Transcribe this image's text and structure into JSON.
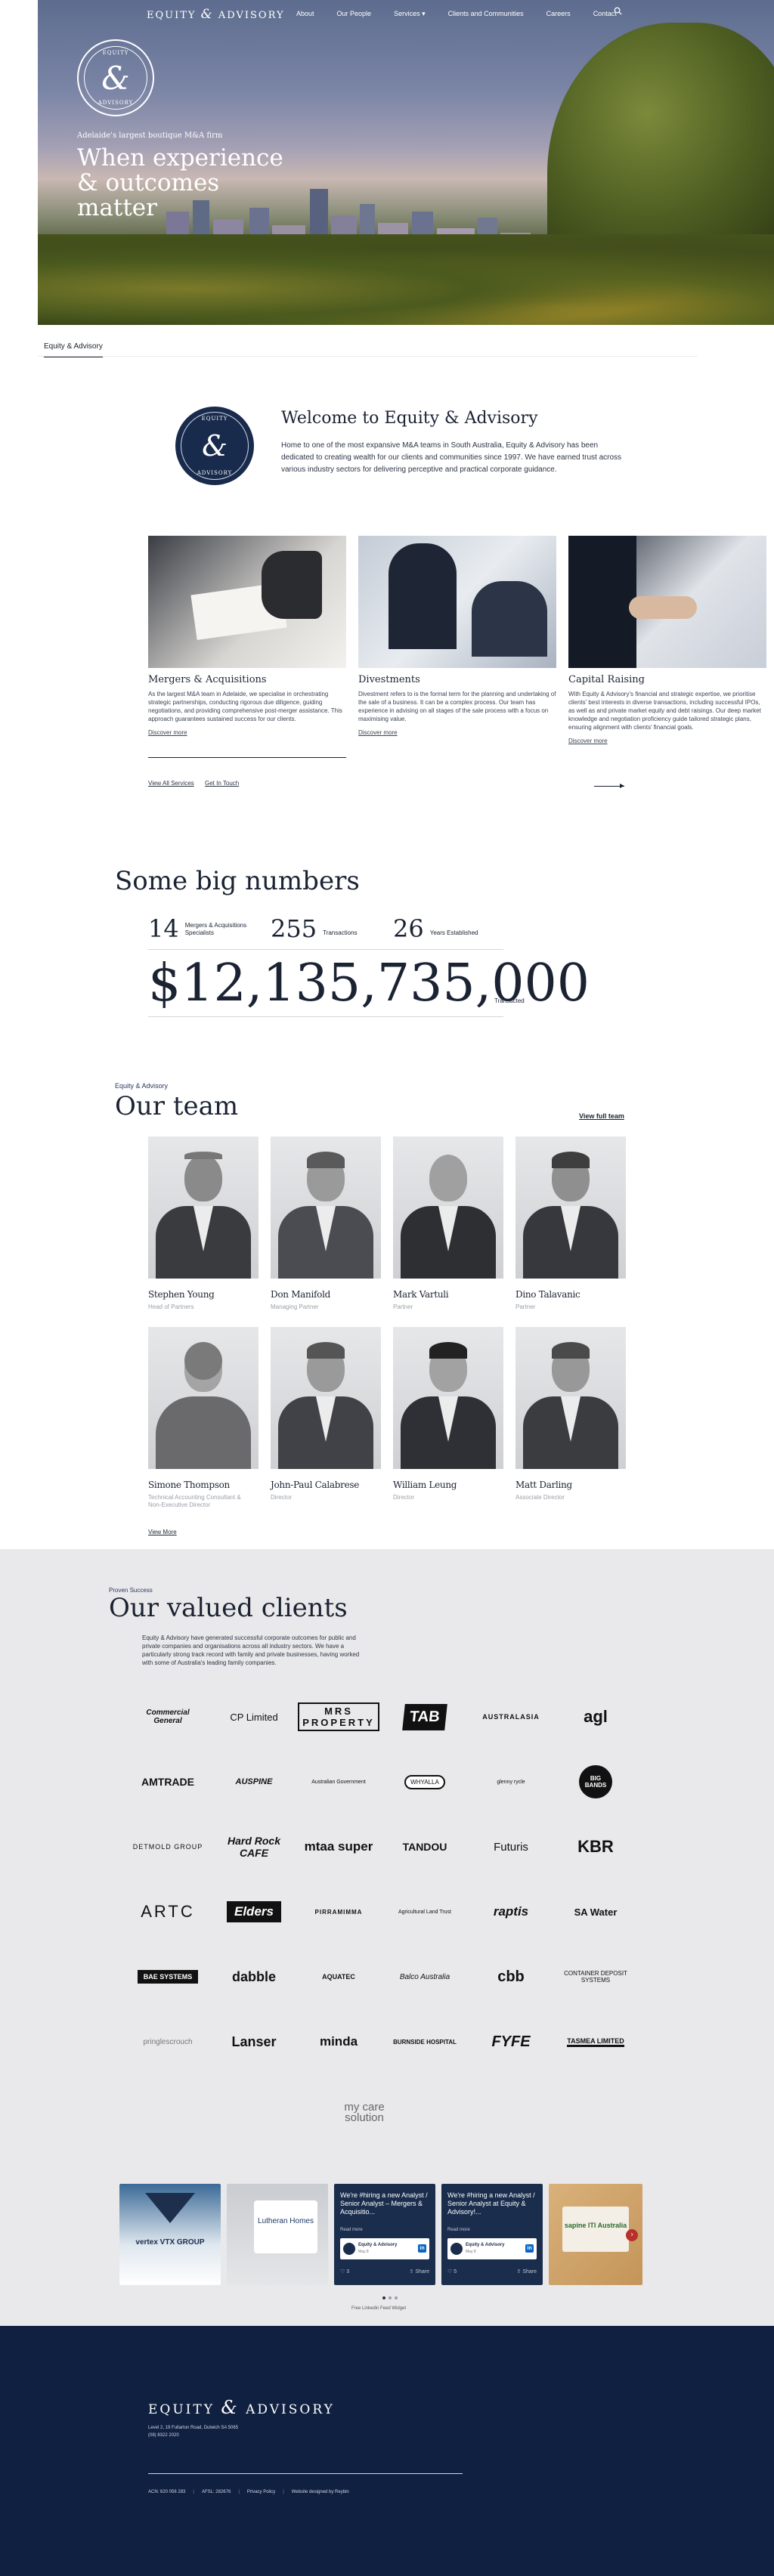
{
  "nav": {
    "brand_left": "EQUITY",
    "brand_amp": "&",
    "brand_right": "ADVISORY",
    "items": [
      "About",
      "Our People",
      "Services",
      "Clients and Communities",
      "Careers",
      "Contact"
    ],
    "services_caret": "▾"
  },
  "hero": {
    "logo_top": "EQUITY",
    "logo_bottom": "ADVISORY",
    "logo_mark": "&",
    "tagline": "Adelaide's largest boutique M&A firm",
    "title": "When experience & outcomes matter"
  },
  "breadcrumb": "Equity & Advisory",
  "welcome": {
    "logo_top": "EQUITY",
    "logo_bottom": "ADVISORY",
    "logo_mark": "&",
    "title": "Welcome to Equity & Advisory",
    "text": "Home to one of the most expansive M&A teams in South Australia, Equity & Advisory has been dedicated to creating wealth for our clients and communities since 1997. We have earned trust across various industry sectors for delivering perceptive and practical corporate guidance."
  },
  "services": {
    "items": [
      {
        "title": "Mergers & Acquisitions",
        "text": "As the largest M&A team in Adelaide, we specialise in orchestrating strategic partnerships, conducting rigorous due diligence, guiding negotiations, and providing comprehensive post-merger assistance. This approach guarantees sustained success for our clients.",
        "link": "Discover more"
      },
      {
        "title": "Divestments",
        "text": "Divestment refers to is the formal term for the planning and undertaking of the sale of a business. It can be a complex process. Our team has experience in advising on all stages of the sale process with a focus on maximising value.",
        "link": "Discover more"
      },
      {
        "title": "Capital Raising",
        "text": "With Equity & Advisory's financial and strategic expertise, we prioritise clients' best interests in diverse transactions, including successful IPOs, as well as and private market equity and debt raisings. Our deep market knowledge and negotiation proficiency guide tailored strategic plans, ensuring alignment with clients' financial goals.",
        "link": "Discover more"
      }
    ],
    "view_all": "View All Services",
    "get_in_touch": "Get In Touch"
  },
  "numbers": {
    "title": "Some big numbers",
    "stats": [
      {
        "value": "14",
        "label": "Mergers & Acquisitions Specialists"
      },
      {
        "value": "255",
        "label": "Transactions"
      },
      {
        "value": "26",
        "label": "Years Established"
      }
    ],
    "big_value": "$12,135,735,000",
    "big_label": "Transacted"
  },
  "team": {
    "kicker": "Equity & Advisory",
    "title": "Our team",
    "view_full": "View full team",
    "members": [
      {
        "name": "Stephen Young",
        "role": "Head of Partners"
      },
      {
        "name": "Don Manifold",
        "role": "Managing Partner"
      },
      {
        "name": "Mark Vartuli",
        "role": "Partner"
      },
      {
        "name": "Dino Talavanic",
        "role": "Partner"
      },
      {
        "name": "Simone Thompson",
        "role": "Technical Accounting Consultant & Non-Executive Director"
      },
      {
        "name": "John-Paul Calabrese",
        "role": "Director"
      },
      {
        "name": "William Leung",
        "role": "Director"
      },
      {
        "name": "Matt Darling",
        "role": "Associate Director"
      }
    ],
    "view_more": "View More"
  },
  "clients": {
    "kicker": "Proven Success",
    "title": "Our valued clients",
    "text": "Equity & Advisory have generated successful corporate outcomes for public and private companies and organisations across all industry sectors. We have a particularly strong track record with family and private businesses, having worked with some of Australia's leading family companies.",
    "logos": [
      "Commercial General",
      "CP Limited",
      "MRS PROPERTY",
      "TAB",
      "AUSTRALASIA",
      "agl",
      "AMTRADE",
      "AUSPINE",
      "Australian Government",
      "WHYALLA",
      "glenny rycle",
      "BIG BANDS",
      "DETMOLD GROUP",
      "Hard Rock CAFE",
      "mtaa super",
      "TANDOU",
      "Futuris",
      "KBR",
      "ARTC",
      "Elders",
      "PIRRAMIMMA",
      "Agricultural Land Trust",
      "raptis",
      "SA Water",
      "BAE SYSTEMS",
      "dabble",
      "AQUATEC",
      "Balco Australia",
      "cbb",
      "CONTAINER DEPOSIT SYSTEMS",
      "pringlescrouch",
      "Lanser",
      "minda",
      "BURNSIDE HOSPITAL",
      "FYFE",
      "TASMEA LIMITED",
      "my care solution"
    ]
  },
  "social": {
    "posts": [
      {
        "caption": "vertex VTX GROUP"
      },
      {
        "caption": "Lutheran Homes"
      },
      {
        "text": "We're #hiring a new Analyst / Senior Analyst – Mergers & Acquisitio...",
        "more": "Read more",
        "author": "Equity & Advisory",
        "date": "May 8",
        "share": "Share",
        "likes": "3"
      },
      {
        "text": "We're #hiring a new Analyst / Senior Analyst at Equity & Advisory!...",
        "more": "Read more",
        "author": "Equity & Advisory",
        "date": "May 8",
        "share": "Share",
        "likes": "5"
      },
      {
        "caption": "sapine ITI Australia"
      }
    ],
    "feed_credit": "Free Linkedin Feed Widget"
  },
  "footer": {
    "brand_left": "EQUITY",
    "brand_amp": "&",
    "brand_right": "ADVISORY",
    "address": "Level 2, 19 Fullarton Road, Dulwich SA 5065",
    "phone": "(08) 8322 2020",
    "acn": "ACN: 620 056 283",
    "afsl": "AFSL: 282676",
    "privacy": "Privacy Policy",
    "credit": "Website designed by Reybin"
  },
  "colors": {
    "navy": "#102040",
    "accent_navy": "#192b4d",
    "gray_bg": "#e9e9eb"
  }
}
